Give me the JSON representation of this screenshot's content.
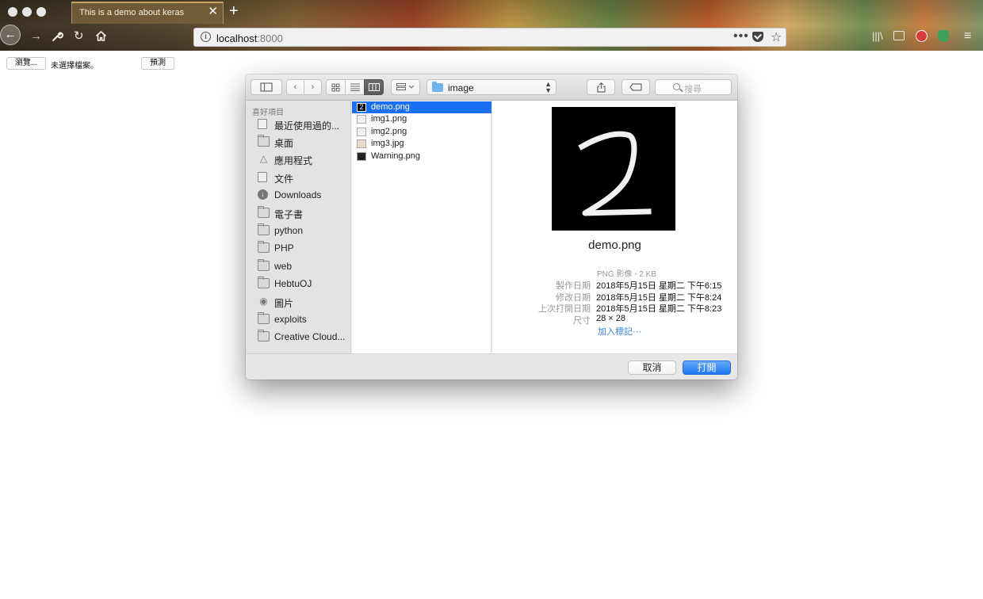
{
  "browser": {
    "tab_title": "This is a demo about keras",
    "tab_close": "✕",
    "new_tab": "+",
    "url_host": "localhost",
    "url_port": ":8000",
    "icons": [
      "back-arrow-icon",
      "forward-arrow-icon",
      "wrench-icon",
      "reload-icon",
      "home-icon",
      "info-icon",
      "more-icon",
      "pocket-icon",
      "bookmark-star-icon",
      "library-icon",
      "sidebar-icon",
      "adblock-icon",
      "shield-icon",
      "menu-icon"
    ]
  },
  "page": {
    "browse_button": "瀏覽...",
    "file_status": "未選擇檔案。",
    "predict_button": "預測"
  },
  "dialog": {
    "location": "image",
    "search_placeholder": "搜尋",
    "accent_color": "#1b6ff2",
    "sidebar": {
      "heading": "喜好項目",
      "items": [
        {
          "label": "最近使用過的...",
          "icon": "recents-icon"
        },
        {
          "label": "桌面",
          "icon": "desktop-icon"
        },
        {
          "label": "應用程式",
          "icon": "applications-icon"
        },
        {
          "label": "文件",
          "icon": "documents-icon"
        },
        {
          "label": "Downloads",
          "icon": "downloads-icon"
        },
        {
          "label": "電子書",
          "icon": "folder-icon"
        },
        {
          "label": "python",
          "icon": "folder-icon"
        },
        {
          "label": "PHP",
          "icon": "folder-icon"
        },
        {
          "label": "web",
          "icon": "folder-icon"
        },
        {
          "label": "HebtuOJ",
          "icon": "folder-icon"
        },
        {
          "label": "圖片",
          "icon": "camera-icon"
        },
        {
          "label": "exploits",
          "icon": "folder-icon"
        },
        {
          "label": "Creative Cloud...",
          "icon": "folder-icon"
        }
      ]
    },
    "files": [
      {
        "name": "demo.png",
        "selected": true
      },
      {
        "name": "img1.png",
        "selected": false
      },
      {
        "name": "img2.png",
        "selected": false
      },
      {
        "name": "img3.jpg",
        "selected": false
      },
      {
        "name": "Warning.png",
        "selected": false
      }
    ],
    "preview": {
      "name": "demo.png",
      "kind": "PNG 影像 - 2 KB",
      "created_label": "製作日期",
      "created_value": "2018年5月15日 星期二 下午6:15",
      "modified_label": "修改日期",
      "modified_value": "2018年5月15日 星期二 下午8:24",
      "opened_label": "上次打開日期",
      "opened_value": "2018年5月15日 星期二 下午8:23",
      "size_label": "尺寸",
      "size_value": "28 × 28",
      "add_tags": "加入標記⋯"
    },
    "cancel_button": "取消",
    "open_button": "打開"
  }
}
